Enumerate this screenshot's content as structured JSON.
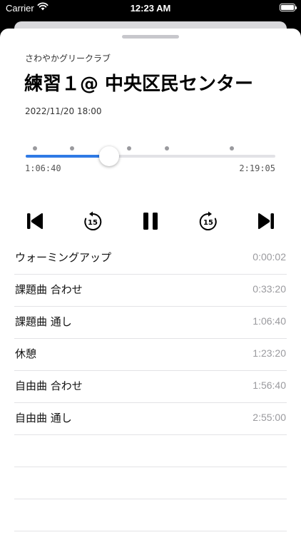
{
  "status_bar": {
    "carrier": "Carrier",
    "time": "12:23 AM"
  },
  "header": {
    "club": "さわやかグリークラブ",
    "title": "練習１@ 中央区民センター",
    "datetime": "2022/11/20 18:00"
  },
  "progress": {
    "elapsed": "1:06:40",
    "total": "2:19:05",
    "fraction": 0.335,
    "markers": [
      0.037,
      0.185,
      0.335,
      0.415,
      0.565,
      0.825
    ]
  },
  "controls": {
    "skip_back_icon": "skip-to-start",
    "rewind_icon": "rewind-15",
    "rewind_label": "15",
    "pause_icon": "pause",
    "forward_icon": "forward-15",
    "forward_label": "15",
    "skip_forward_icon": "skip-to-end"
  },
  "sections": [
    {
      "name": "ウォーミングアップ",
      "time": "0:00:02"
    },
    {
      "name": "課題曲 合わせ",
      "time": "0:33:20"
    },
    {
      "name": "課題曲 通し",
      "time": "1:06:40"
    },
    {
      "name": "休憩",
      "time": "1:23:20"
    },
    {
      "name": "自由曲 合わせ",
      "time": "1:56:40"
    },
    {
      "name": "自由曲 通し",
      "time": "2:55:00"
    }
  ],
  "colors": {
    "accent": "#2f7ae5",
    "track": "#e2e2e6",
    "secondary_text": "#9a9a9e"
  }
}
